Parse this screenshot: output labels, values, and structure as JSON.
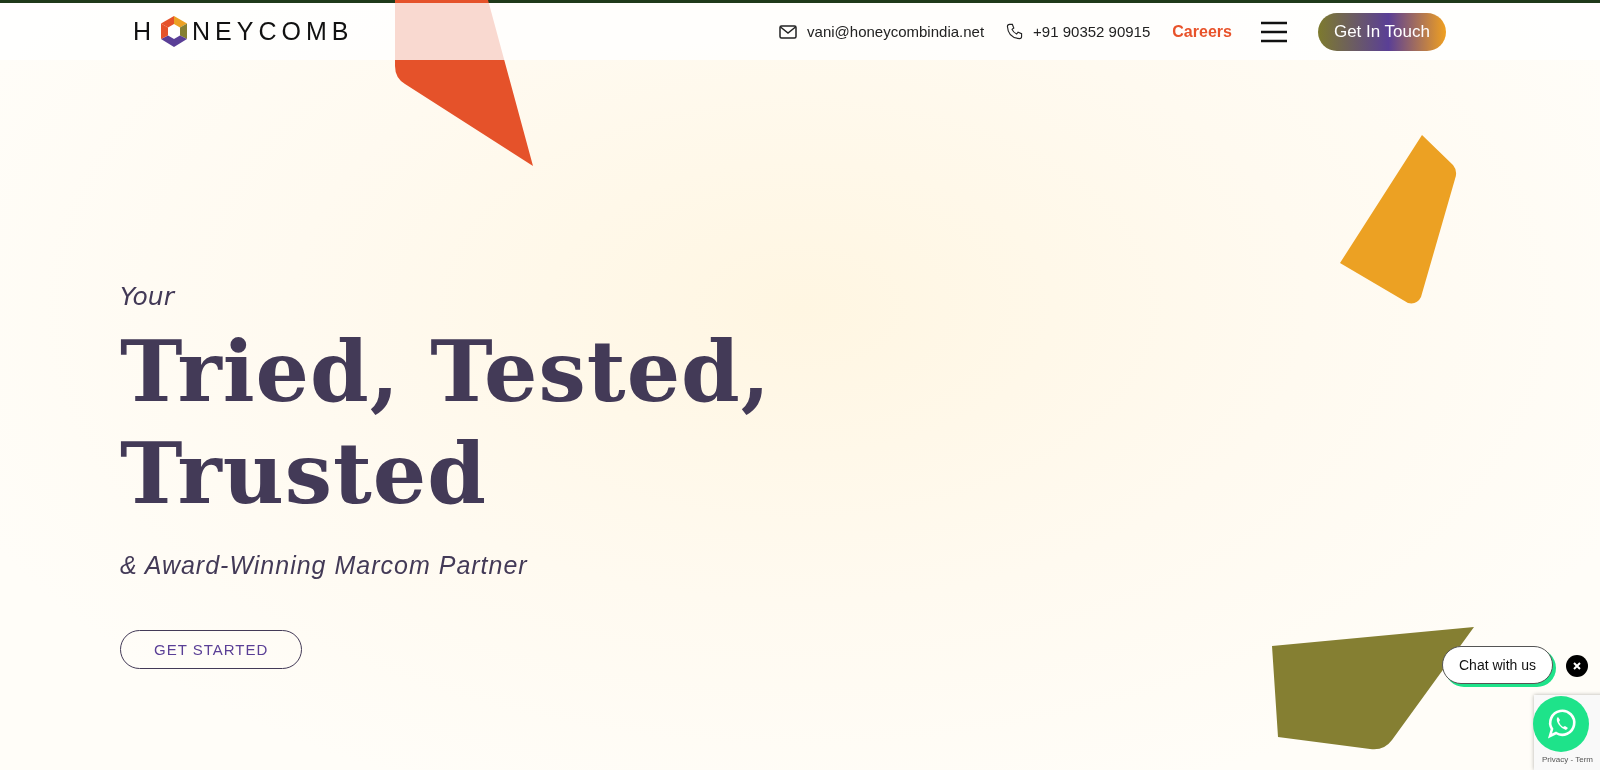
{
  "header": {
    "logo_start": "H",
    "logo_end": "NEYCOMB",
    "email": "vani@honeycombindia.net",
    "phone": "+91 90352 90915",
    "careers": "Careers",
    "cta": "Get In Touch"
  },
  "hero": {
    "eyebrow": "Your",
    "title_lines": [
      "Tried, Tested,",
      "Trusted"
    ],
    "subtitle": "& Award-Winning Marcom Partner",
    "button": "GET STARTED"
  },
  "chat": {
    "label": "Chat with us"
  },
  "recaptcha": {
    "text": "Privacy - Term"
  }
}
